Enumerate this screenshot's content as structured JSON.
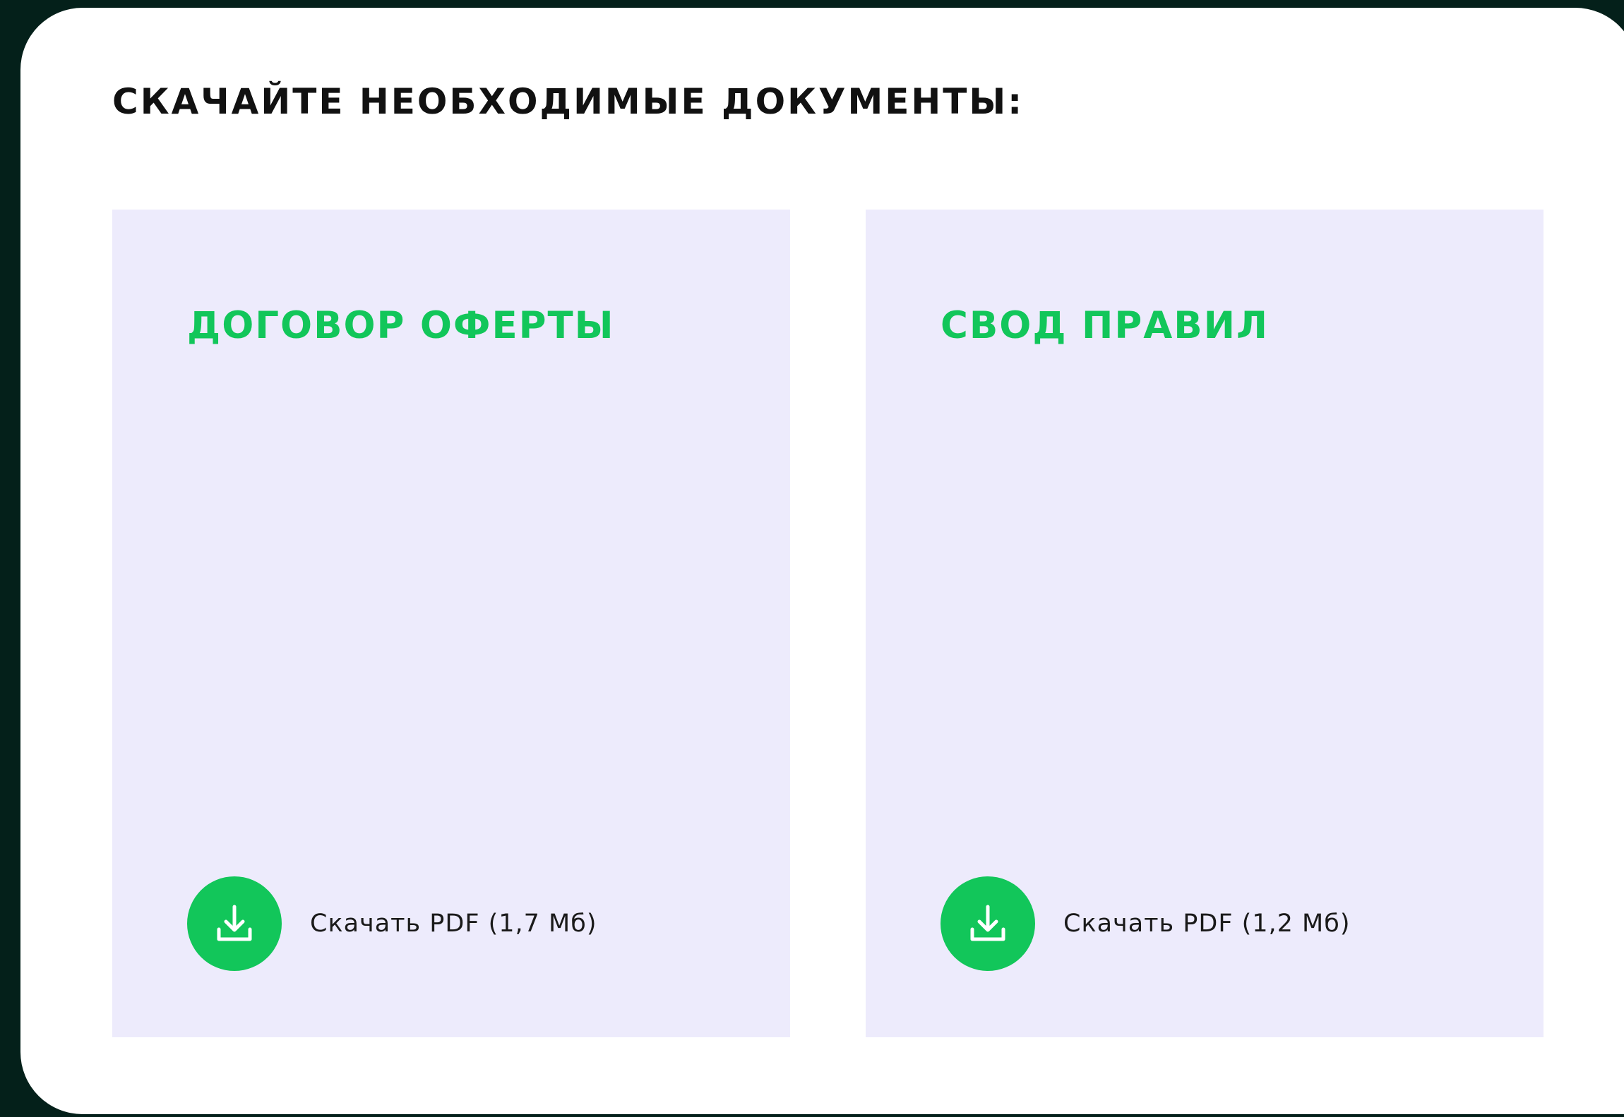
{
  "heading": "СКАЧАЙТЕ НЕОБХОДИМЫЕ ДОКУМЕНТЫ:",
  "colors": {
    "background": "#04201a",
    "panel": "#ffffff",
    "card": "#edebfc",
    "accent": "#12c65a",
    "text": "#111111"
  },
  "documents": [
    {
      "title": "ДОГОВОР ОФЕРТЫ",
      "download_label": "Скачать PDF (1,7 Мб)",
      "icon": "download-icon"
    },
    {
      "title": "СВОД ПРАВИЛ",
      "download_label": "Скачать PDF (1,2 Мб)",
      "icon": "download-icon"
    }
  ]
}
